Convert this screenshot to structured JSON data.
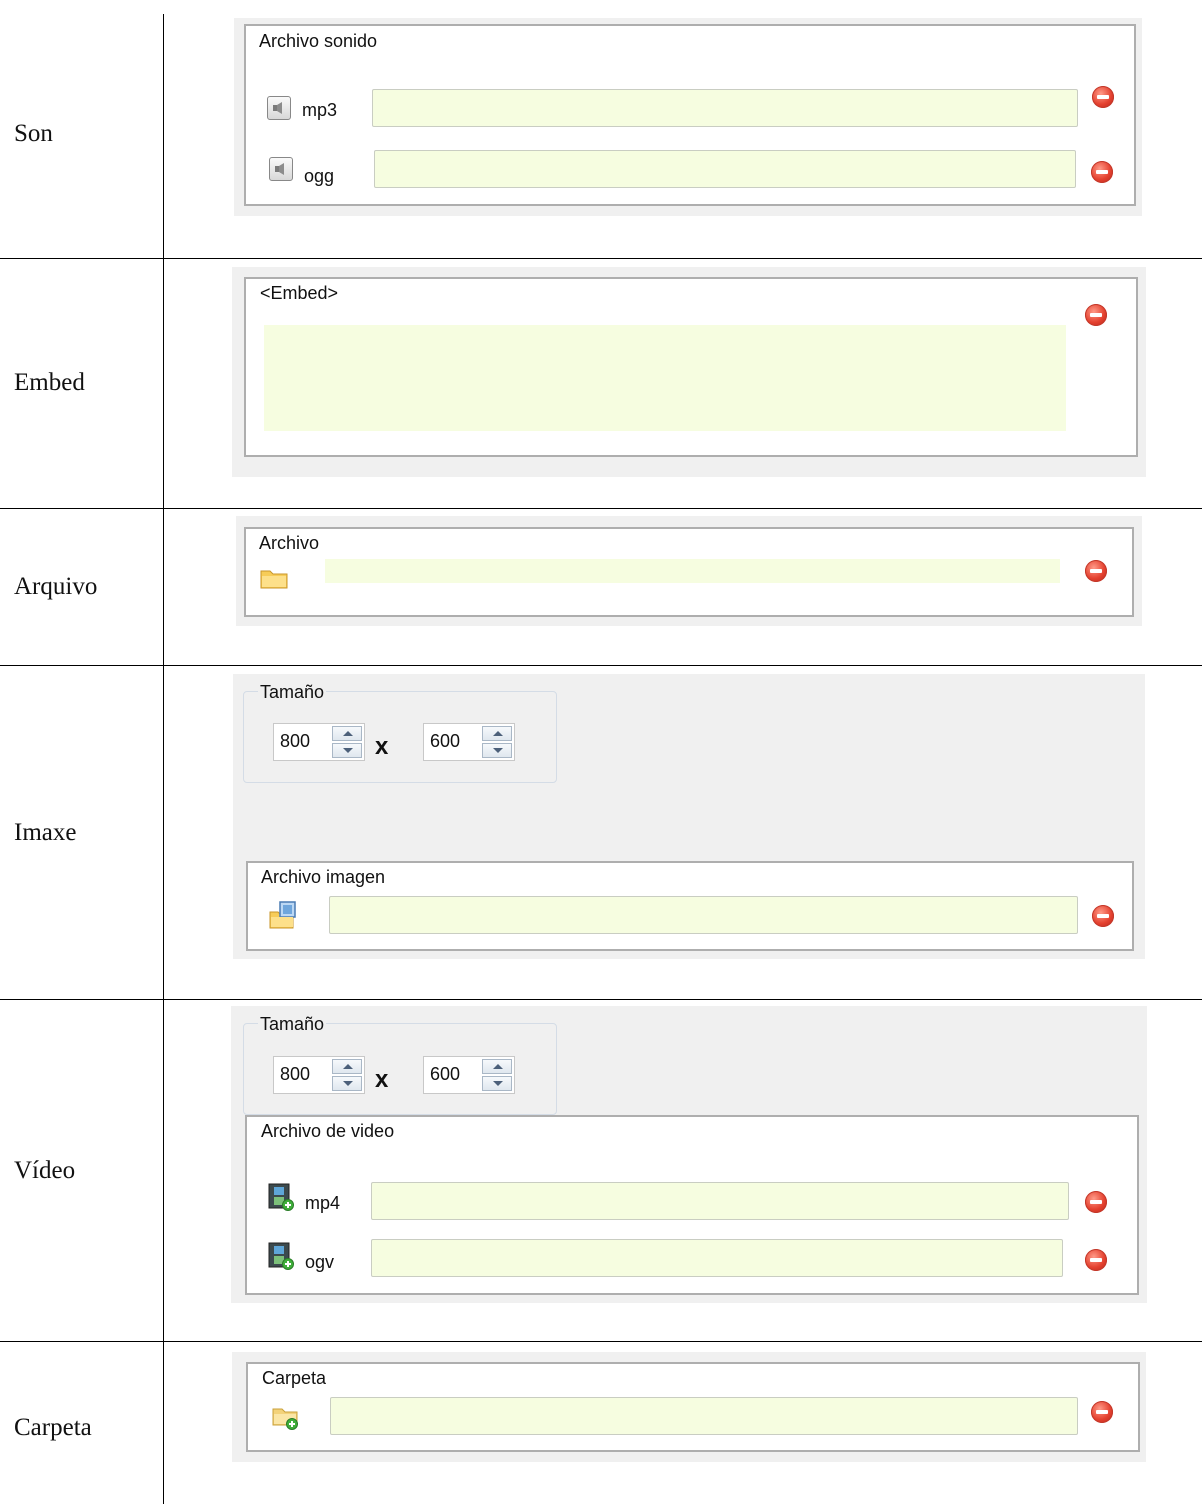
{
  "rows": [
    {
      "label": "Son",
      "group_title": "Archivo sonido",
      "files": [
        {
          "ext": "mp3",
          "icon": "speaker-icon",
          "value": ""
        },
        {
          "ext": "ogg",
          "icon": "speaker-icon",
          "value": ""
        }
      ]
    },
    {
      "label": "Embed",
      "group_title": "<Embed>",
      "value": ""
    },
    {
      "label": "Arquivo",
      "group_title": "Archivo",
      "icon": "folder-icon",
      "value": ""
    },
    {
      "label": "Imaxe",
      "size": {
        "title": "Tamaño",
        "width": "800",
        "height": "600",
        "separator": "x"
      },
      "group_title": "Archivo imagen",
      "icon": "image-folder-icon",
      "value": ""
    },
    {
      "label": "Vídeo",
      "size": {
        "title": "Tamaño",
        "width": "800",
        "height": "600",
        "separator": "x"
      },
      "group_title": "Archivo de video",
      "files": [
        {
          "ext": "mp4",
          "icon": "film-add-icon",
          "value": ""
        },
        {
          "ext": "ogv",
          "icon": "film-add-icon",
          "value": ""
        }
      ]
    },
    {
      "label": "Carpeta",
      "group_title": "Carpeta",
      "icon": "folder-add-icon",
      "value": ""
    }
  ],
  "colors": {
    "field_bg": "#f6fde0",
    "panel_bg": "#f0f0f0",
    "remove_red": "#e4412f"
  }
}
